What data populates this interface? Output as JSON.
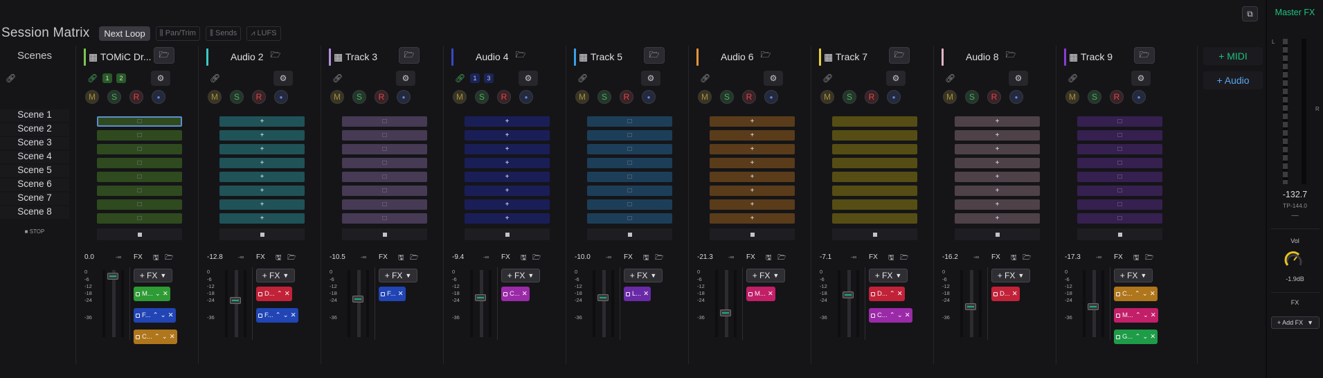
{
  "header": {
    "title": "Session Matrix",
    "loop_button": "Next Loop",
    "chips": [
      {
        "icon": "pan-icon",
        "label": "Pan/Trim"
      },
      {
        "icon": "sends-icon",
        "label": "Sends"
      },
      {
        "icon": "lufs-icon",
        "label": "LUFS"
      }
    ]
  },
  "scenes": {
    "title": "Scenes",
    "items": [
      "Scene 1",
      "Scene 2",
      "Scene 3",
      "Scene 4",
      "Scene 5",
      "Scene 6",
      "Scene 7",
      "Scene 8"
    ],
    "stop_label": "STOP"
  },
  "tracks": [
    {
      "name": "TOMiC Dr...",
      "type": "midi",
      "color": "#7ac74f",
      "volume": "0.0",
      "peak": "-∞",
      "fader_level": 0.95,
      "clip_color": "#2f4a1f",
      "clip_glyph": "□",
      "link_color": "#47b060",
      "channels": [
        "1",
        "2"
      ],
      "plugins": [
        {
          "label": "M...",
          "color": "#2e9b34",
          "arrows": "down",
          "close": true
        },
        {
          "label": "F...",
          "color": "#2145b5",
          "arrows": "updown",
          "close": true
        },
        {
          "label": "C...",
          "color": "#b0761c",
          "arrows": "updown",
          "close": true
        }
      ]
    },
    {
      "name": "Audio 2",
      "type": "audio",
      "color": "#3bc9c9",
      "volume": "-12.8",
      "peak": "-∞",
      "fader_level": 0.55,
      "clip_color": "#1f5358",
      "clip_glyph": "+",
      "link_color": "#9a9aa0",
      "channels": [],
      "plugins": [
        {
          "label": "D...",
          "color": "#c22238",
          "arrows": "up",
          "close": true
        },
        {
          "label": "F...",
          "color": "#2145b5",
          "arrows": "updown",
          "close": true
        }
      ]
    },
    {
      "name": "Track 3",
      "type": "midi",
      "color": "#b58fe0",
      "volume": "-10.5",
      "peak": "-∞",
      "fader_level": 0.58,
      "clip_color": "#463a55",
      "clip_glyph": "□",
      "link_color": "#9a9aa0",
      "channels": [],
      "plugins": [
        {
          "label": "F...",
          "color": "#2145b5",
          "arrows": "",
          "close": true
        }
      ]
    },
    {
      "name": "Audio 4",
      "type": "audio",
      "color": "#3a48c8",
      "volume": "-9.4",
      "peak": "-∞",
      "fader_level": 0.6,
      "clip_color": "#1a1e57",
      "clip_glyph": "+",
      "link_color": "#47b060",
      "channels": [
        "1",
        "3"
      ],
      "plugins": [
        {
          "label": "C...",
          "color": "#9b2aa8",
          "arrows": "",
          "close": true
        }
      ]
    },
    {
      "name": "Track 5",
      "type": "midi",
      "color": "#3aa0e6",
      "volume": "-10.0",
      "peak": "-∞",
      "fader_level": 0.6,
      "clip_color": "#1d3e58",
      "clip_glyph": "□",
      "link_color": "#9a9aa0",
      "channels": [],
      "plugins": [
        {
          "label": "L...",
          "color": "#6a2aa8",
          "arrows": "",
          "close": true
        }
      ]
    },
    {
      "name": "Audio 6",
      "type": "audio",
      "color": "#e8943a",
      "volume": "-21.3",
      "peak": "-∞",
      "fader_level": 0.35,
      "clip_color": "#5a3c1a",
      "clip_glyph": "+",
      "link_color": "#9a9aa0",
      "channels": [],
      "plugins": [
        {
          "label": "M...",
          "color": "#c21f68",
          "arrows": "",
          "close": true
        }
      ]
    },
    {
      "name": "Track 7",
      "type": "midi",
      "color": "#e6d23a",
      "volume": "-7.1",
      "peak": "-∞",
      "fader_level": 0.64,
      "clip_color": "#554d14",
      "clip_glyph": "",
      "link_color": "#9a9aa0",
      "channels": [],
      "plugins": [
        {
          "label": "D...",
          "color": "#c22238",
          "arrows": "up",
          "close": true
        },
        {
          "label": "C...",
          "color": "#9b2aa8",
          "arrows": "updown",
          "close": true
        }
      ]
    },
    {
      "name": "Audio 8",
      "type": "audio",
      "color": "#e0b5c8",
      "volume": "-16.2",
      "peak": "-∞",
      "fader_level": 0.45,
      "clip_color": "#4e4148",
      "clip_glyph": "+",
      "link_color": "#9a9aa0",
      "channels": [],
      "plugins": [
        {
          "label": "D...",
          "color": "#c22238",
          "arrows": "",
          "close": true
        }
      ]
    },
    {
      "name": "Track 9",
      "type": "midi",
      "color": "#8a3ad8",
      "volume": "-17.3",
      "peak": "-∞",
      "fader_level": 0.45,
      "clip_color": "#35204f",
      "clip_glyph": "□",
      "link_color": "#9a9aa0",
      "channels": [],
      "plugins": [
        {
          "label": "C...",
          "color": "#b0761c",
          "arrows": "updown",
          "close": true
        },
        {
          "label": "M...",
          "color": "#c21f68",
          "arrows": "updown",
          "close": true
        },
        {
          "label": "G...",
          "color": "#1e9c48",
          "arrows": "updown",
          "close": true
        }
      ]
    }
  ],
  "strip_buttons": {
    "mute": "M",
    "solo": "S",
    "record": "R"
  },
  "mixer": {
    "fx_label": "FX",
    "add_fx": "+ FX",
    "scale": [
      "0",
      "-6",
      "-12",
      "-18",
      "-24",
      "-36"
    ]
  },
  "add_midi": "+ MIDI",
  "add_audio": "+ Audio",
  "master": {
    "title": "Master FX",
    "left": "L",
    "right": "R",
    "level": "-132.7",
    "true_peak": "TP-144.0",
    "dash": "—",
    "vol_label": "Vol",
    "vol_value": "-1.9dB",
    "fx_label": "FX",
    "add_fx": "+ Add FX",
    "accent": "#20c27c"
  }
}
